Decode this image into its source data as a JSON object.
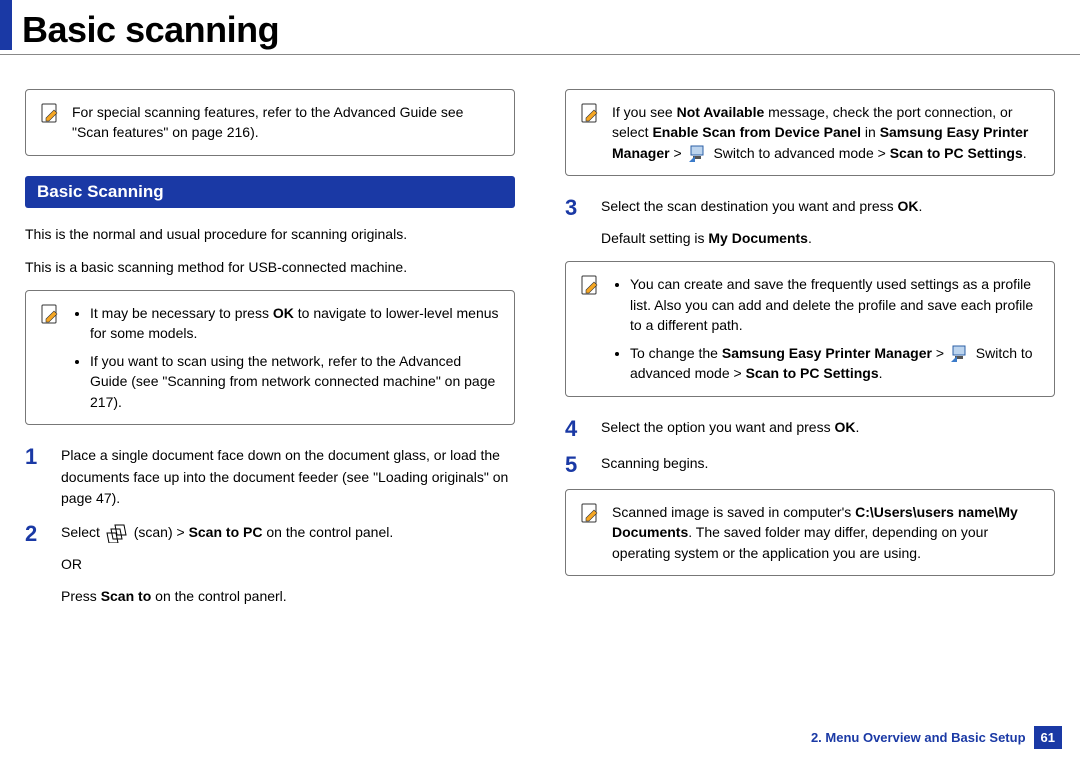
{
  "title": "Basic scanning",
  "left": {
    "note1": "For special scanning features, refer to the Advanced Guide see \"Scan features\" on page 216).",
    "sectionHead": "Basic Scanning",
    "p1": "This is the normal and usual procedure for scanning originals.",
    "p2": "This is a basic scanning method for USB-connected machine.",
    "note2": {
      "li1a": "It may be necessary to press ",
      "li1b": "OK",
      "li1c": " to navigate to lower-level menus for some models.",
      "li2": "If you want to scan using the network, refer to the Advanced Guide (see \"Scanning from network connected machine\" on page 217)."
    },
    "step1": "Place a single document face down on the document glass, or load the documents face up into the document feeder (see \"Loading originals\" on page 47).",
    "step2": {
      "a": "Select ",
      "b": "(scan) > ",
      "c": "Scan to PC",
      "d": " on the control panel.",
      "or": "OR",
      "e1": "Press ",
      "e2": "Scan to",
      "e3": " on the control panerl."
    }
  },
  "right": {
    "note1": {
      "a": "If you see ",
      "b": "Not Available",
      "c": " message, check the port connection, or select ",
      "d": "Enable Scan from Device Panel",
      "e": " in ",
      "f": "Samsung Easy Printer Manager",
      "g": " > ",
      "h": " Switch to advanced mode > ",
      "i": "Scan to PC Settings",
      "j": "."
    },
    "step3": {
      "a": "Select the scan destination you want and press ",
      "b": "OK",
      "c": ".",
      "d": "Default setting is ",
      "e": "My Documents",
      "f": "."
    },
    "note2": {
      "li1": "You can create and save the frequently used settings as a profile list. Also you can add and delete the profile and save each profile to a different path.",
      "li2a": "To change the ",
      "li2b": "Samsung Easy Printer Manager",
      "li2c": " > ",
      "li2d": " Switch to advanced mode > ",
      "li2e": "Scan to PC Settings",
      "li2f": "."
    },
    "step4": {
      "a": "Select the option you want and press ",
      "b": "OK",
      "c": "."
    },
    "step5": "Scanning begins.",
    "note3": {
      "a": "Scanned image is saved in computer's ",
      "b": "C:\\Users\\users name\\My Documents",
      "c": ". The saved folder may differ, depending on your operating system or the application you are using."
    }
  },
  "footer": {
    "chapter": "2. Menu Overview and Basic Setup",
    "page": "61"
  }
}
